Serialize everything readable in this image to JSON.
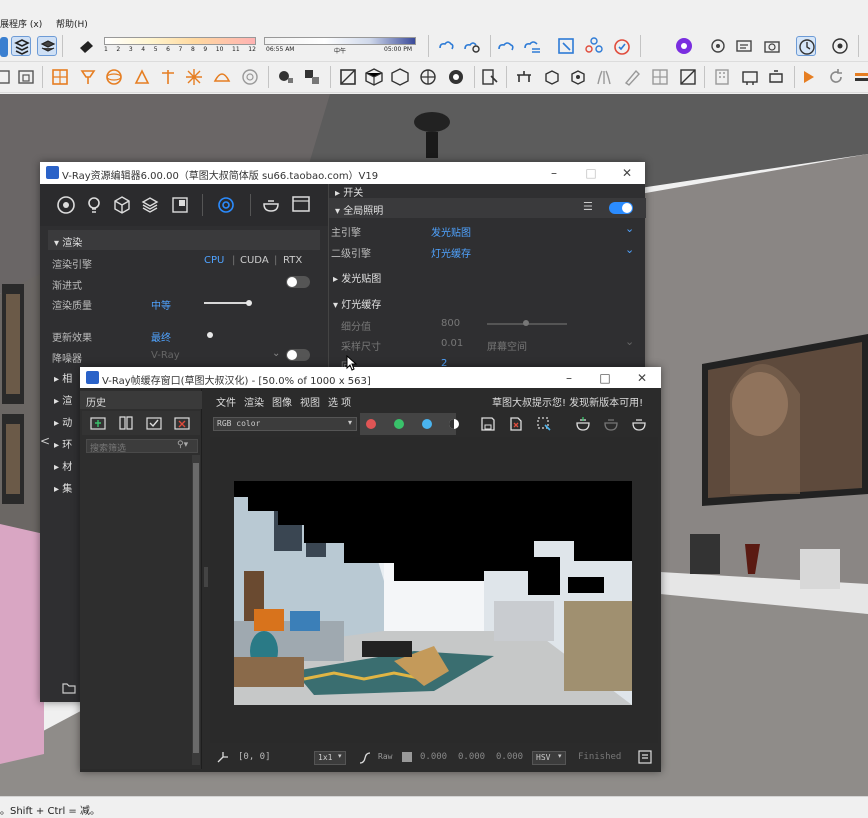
{
  "menubar": {
    "items": [
      "展程序 (x)",
      "帮助(H)"
    ]
  },
  "toolbar": {
    "shadow_hours": [
      "1",
      "2",
      "3",
      "4",
      "5",
      "6",
      "7",
      "8",
      "9",
      "10",
      "11",
      "12"
    ],
    "time_start": "06:55 AM",
    "time_mid": "中午",
    "time_end": "05:00 PM"
  },
  "status": {
    "hint": "。Shift + Ctrl = 减。"
  },
  "editor": {
    "title": "V-Ray资源编辑器6.00.00（草图大叔简体版 su66.taobao.com）V19",
    "sections": {
      "render": "渲染",
      "switch": "开关",
      "gi": "全局照明",
      "irradiance": "发光贴图",
      "light_cache": "灯光缓存"
    },
    "render_rows": {
      "engine_label": "渲染引擎",
      "engine_cpu": "CPU",
      "engine_cuda": "CUDA",
      "engine_rtx": "RTX",
      "progressive_label": "渐进式",
      "quality_label": "渲染质量",
      "quality_value": "中等",
      "update_label": "更新效果",
      "update_value": "最终",
      "denoiser_label": "降噪器",
      "denoiser_value": "V-Ray"
    },
    "left_collapsed": [
      "相",
      "渲",
      "动",
      "环",
      "材",
      "集"
    ],
    "gi_rows": {
      "primary_label": "主引擎",
      "primary_value": "发光贴图",
      "secondary_label": "二级引擎",
      "secondary_value": "灯光缓存"
    },
    "light_cache_rows": {
      "subdiv_label": "细分值",
      "subdiv_value": "800",
      "sample_label": "采样尺寸",
      "sample_value": "0.01",
      "scale_value": "屏幕空间",
      "passes_label": "回",
      "passes_value": "2"
    }
  },
  "vfb": {
    "title": "V-Ray帧缓存窗口(草图大叔汉化) - [50.0% of 1000 x 563]",
    "history_label": "历史",
    "search_placeholder": "搜索筛选",
    "menu": [
      "文件",
      "渲染",
      "图像",
      "视图",
      "选 项"
    ],
    "notice": "草图大叔提示您! 发现新版本可用!",
    "channel": "RGB color",
    "coords": "[0, 0]",
    "zoom": "1x1",
    "mode": "Raw",
    "values": [
      "0.000",
      "0.000",
      "0.000"
    ],
    "colorspace": "HSV",
    "status": "Finished"
  },
  "colors": {
    "accent": "#2b8cff",
    "editor_bg": "#2f2f31",
    "vfb_bg": "#2b2b2b"
  }
}
